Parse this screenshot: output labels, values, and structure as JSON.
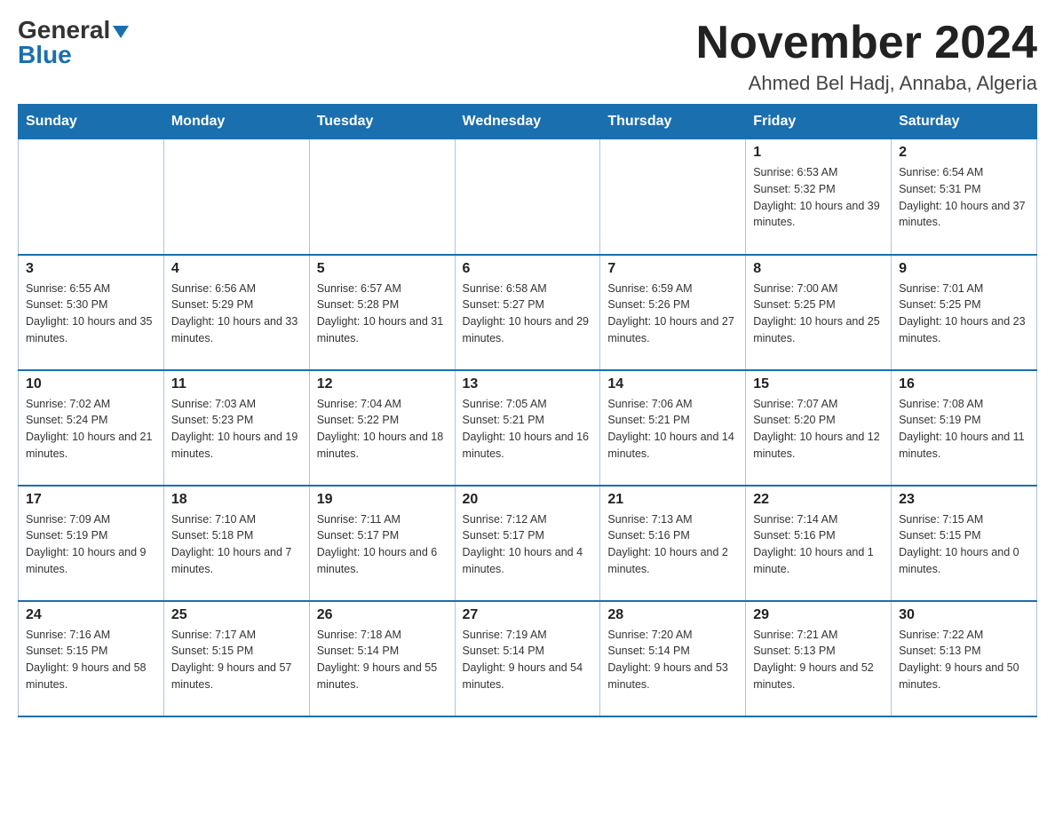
{
  "header": {
    "logo_general": "General",
    "logo_blue": "Blue",
    "month_title": "November 2024",
    "location": "Ahmed Bel Hadj, Annaba, Algeria"
  },
  "weekdays": [
    "Sunday",
    "Monday",
    "Tuesday",
    "Wednesday",
    "Thursday",
    "Friday",
    "Saturday"
  ],
  "weeks": [
    [
      {
        "day": "",
        "info": ""
      },
      {
        "day": "",
        "info": ""
      },
      {
        "day": "",
        "info": ""
      },
      {
        "day": "",
        "info": ""
      },
      {
        "day": "",
        "info": ""
      },
      {
        "day": "1",
        "info": "Sunrise: 6:53 AM\nSunset: 5:32 PM\nDaylight: 10 hours and 39 minutes."
      },
      {
        "day": "2",
        "info": "Sunrise: 6:54 AM\nSunset: 5:31 PM\nDaylight: 10 hours and 37 minutes."
      }
    ],
    [
      {
        "day": "3",
        "info": "Sunrise: 6:55 AM\nSunset: 5:30 PM\nDaylight: 10 hours and 35 minutes."
      },
      {
        "day": "4",
        "info": "Sunrise: 6:56 AM\nSunset: 5:29 PM\nDaylight: 10 hours and 33 minutes."
      },
      {
        "day": "5",
        "info": "Sunrise: 6:57 AM\nSunset: 5:28 PM\nDaylight: 10 hours and 31 minutes."
      },
      {
        "day": "6",
        "info": "Sunrise: 6:58 AM\nSunset: 5:27 PM\nDaylight: 10 hours and 29 minutes."
      },
      {
        "day": "7",
        "info": "Sunrise: 6:59 AM\nSunset: 5:26 PM\nDaylight: 10 hours and 27 minutes."
      },
      {
        "day": "8",
        "info": "Sunrise: 7:00 AM\nSunset: 5:25 PM\nDaylight: 10 hours and 25 minutes."
      },
      {
        "day": "9",
        "info": "Sunrise: 7:01 AM\nSunset: 5:25 PM\nDaylight: 10 hours and 23 minutes."
      }
    ],
    [
      {
        "day": "10",
        "info": "Sunrise: 7:02 AM\nSunset: 5:24 PM\nDaylight: 10 hours and 21 minutes."
      },
      {
        "day": "11",
        "info": "Sunrise: 7:03 AM\nSunset: 5:23 PM\nDaylight: 10 hours and 19 minutes."
      },
      {
        "day": "12",
        "info": "Sunrise: 7:04 AM\nSunset: 5:22 PM\nDaylight: 10 hours and 18 minutes."
      },
      {
        "day": "13",
        "info": "Sunrise: 7:05 AM\nSunset: 5:21 PM\nDaylight: 10 hours and 16 minutes."
      },
      {
        "day": "14",
        "info": "Sunrise: 7:06 AM\nSunset: 5:21 PM\nDaylight: 10 hours and 14 minutes."
      },
      {
        "day": "15",
        "info": "Sunrise: 7:07 AM\nSunset: 5:20 PM\nDaylight: 10 hours and 12 minutes."
      },
      {
        "day": "16",
        "info": "Sunrise: 7:08 AM\nSunset: 5:19 PM\nDaylight: 10 hours and 11 minutes."
      }
    ],
    [
      {
        "day": "17",
        "info": "Sunrise: 7:09 AM\nSunset: 5:19 PM\nDaylight: 10 hours and 9 minutes."
      },
      {
        "day": "18",
        "info": "Sunrise: 7:10 AM\nSunset: 5:18 PM\nDaylight: 10 hours and 7 minutes."
      },
      {
        "day": "19",
        "info": "Sunrise: 7:11 AM\nSunset: 5:17 PM\nDaylight: 10 hours and 6 minutes."
      },
      {
        "day": "20",
        "info": "Sunrise: 7:12 AM\nSunset: 5:17 PM\nDaylight: 10 hours and 4 minutes."
      },
      {
        "day": "21",
        "info": "Sunrise: 7:13 AM\nSunset: 5:16 PM\nDaylight: 10 hours and 2 minutes."
      },
      {
        "day": "22",
        "info": "Sunrise: 7:14 AM\nSunset: 5:16 PM\nDaylight: 10 hours and 1 minute."
      },
      {
        "day": "23",
        "info": "Sunrise: 7:15 AM\nSunset: 5:15 PM\nDaylight: 10 hours and 0 minutes."
      }
    ],
    [
      {
        "day": "24",
        "info": "Sunrise: 7:16 AM\nSunset: 5:15 PM\nDaylight: 9 hours and 58 minutes."
      },
      {
        "day": "25",
        "info": "Sunrise: 7:17 AM\nSunset: 5:15 PM\nDaylight: 9 hours and 57 minutes."
      },
      {
        "day": "26",
        "info": "Sunrise: 7:18 AM\nSunset: 5:14 PM\nDaylight: 9 hours and 55 minutes."
      },
      {
        "day": "27",
        "info": "Sunrise: 7:19 AM\nSunset: 5:14 PM\nDaylight: 9 hours and 54 minutes."
      },
      {
        "day": "28",
        "info": "Sunrise: 7:20 AM\nSunset: 5:14 PM\nDaylight: 9 hours and 53 minutes."
      },
      {
        "day": "29",
        "info": "Sunrise: 7:21 AM\nSunset: 5:13 PM\nDaylight: 9 hours and 52 minutes."
      },
      {
        "day": "30",
        "info": "Sunrise: 7:22 AM\nSunset: 5:13 PM\nDaylight: 9 hours and 50 minutes."
      }
    ]
  ]
}
